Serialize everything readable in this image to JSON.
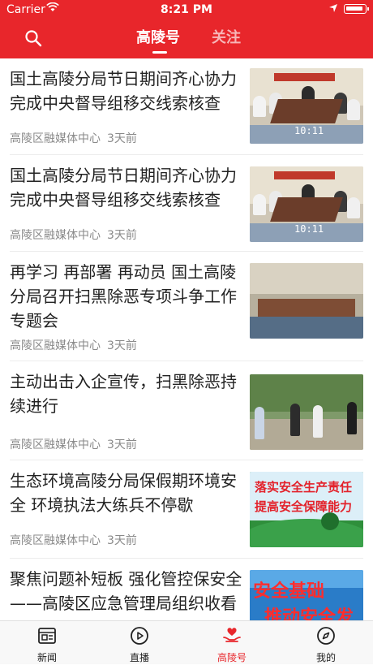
{
  "status_bar": {
    "carrier": "Carrier",
    "time": "8:21 PM"
  },
  "header": {
    "tabs": [
      {
        "label": "高陵号",
        "active": true
      },
      {
        "label": "关注",
        "active": false
      }
    ],
    "search_icon": "search-icon"
  },
  "feed": [
    {
      "title": "国土高陵分局节日期间齐心协力完成中央督导组移交线索核查",
      "source": "高陵区融媒体中心",
      "time": "3天前",
      "thumb_stamp": "10:11"
    },
    {
      "title": "国土高陵分局节日期间齐心协力完成中央督导组移交线索核查",
      "source": "高陵区融媒体中心",
      "time": "3天前",
      "thumb_stamp": "10:11"
    },
    {
      "title": "再学习 再部署 再动员 国土高陵分局召开扫黑除恶专项斗争工作专题会",
      "source": "高陵区融媒体中心",
      "time": "3天前"
    },
    {
      "title": "主动出击入企宣传，扫黑除恶持续进行",
      "source": "高陵区融媒体中心",
      "time": "3天前"
    },
    {
      "title": "生态环境高陵分局保假期环境安全 环境执法大练兵不停歇",
      "source": "高陵区融媒体中心",
      "time": "3天前",
      "thumb_line1": "落实安全生产责任",
      "thumb_line2": "提高安全保障能力"
    },
    {
      "title": "聚焦问题补短板 强化管控保安全——高陵区应急管理局组织收看",
      "source": "",
      "time": "",
      "thumb_line1": "安全基础",
      "thumb_line2": "推动安全发"
    }
  ],
  "tabbar": [
    {
      "label": "新闻",
      "icon": "news-icon",
      "active": false
    },
    {
      "label": "直播",
      "icon": "play-icon",
      "active": false
    },
    {
      "label": "高陵号",
      "icon": "heart-hand-icon",
      "active": true
    },
    {
      "label": "我的",
      "icon": "compass-icon",
      "active": false
    }
  ],
  "colors": {
    "brand": "#e8262b",
    "meta": "#8a8a8a",
    "title": "#222222"
  }
}
